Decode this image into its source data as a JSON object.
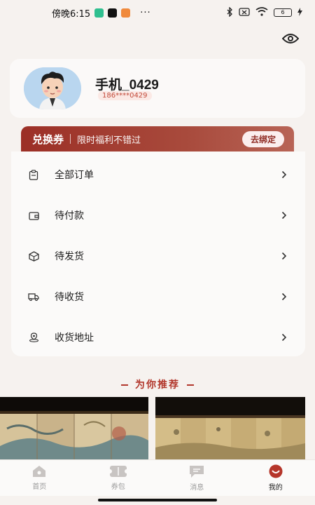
{
  "status_bar": {
    "time": "傍晚6:15",
    "more": "···",
    "battery": "6"
  },
  "profile": {
    "name": "手机_0429",
    "phone": "186****0429"
  },
  "coupon": {
    "title": "兑换券",
    "description": "限时福利不错过",
    "button": "去绑定"
  },
  "menu": {
    "items": [
      {
        "label": "全部订单",
        "icon": "clipboard-icon"
      },
      {
        "label": "待付款",
        "icon": "wallet-icon"
      },
      {
        "label": "待发货",
        "icon": "box-icon"
      },
      {
        "label": "待收货",
        "icon": "truck-icon"
      },
      {
        "label": "收货地址",
        "icon": "location-icon"
      }
    ]
  },
  "recommend": {
    "title": "为你推荐"
  },
  "tabs": [
    {
      "label": "首页",
      "icon": "home-icon"
    },
    {
      "label": "券包",
      "icon": "ticket-icon"
    },
    {
      "label": "消息",
      "icon": "message-icon"
    },
    {
      "label": "我的",
      "icon": "profile-icon",
      "active": true
    }
  ],
  "colors": {
    "accent": "#b2372c",
    "coupon_bg": "#9c2f26",
    "background": "#f6f2ef"
  }
}
